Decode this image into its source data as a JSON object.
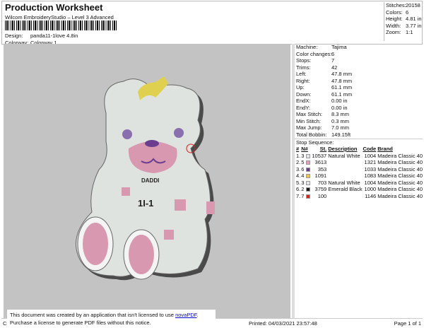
{
  "header": {
    "title": "Production Worksheet",
    "subtitle": "Wilcom EmbroideryStudio – Level 3 Advanced",
    "design_label": "Design:",
    "design": "panda11-1love 4.8in",
    "colorway_label": "Colorway:",
    "colorway": "Colorway 1"
  },
  "stats": [
    {
      "k": "Stitches:",
      "v": "20158"
    },
    {
      "k": "Colors:",
      "v": "6"
    },
    {
      "k": "Height:",
      "v": "4.81 in"
    },
    {
      "k": "Width:",
      "v": "3.77 in"
    },
    {
      "k": "Zoom:",
      "v": "1:1"
    }
  ],
  "machine": [
    {
      "k": "Machine:",
      "v": "Tajima"
    },
    {
      "k": "Color changes:",
      "v": "6"
    },
    {
      "k": "Stops:",
      "v": "7"
    },
    {
      "k": "Trims:",
      "v": "42"
    },
    {
      "k": "Left:",
      "v": "47.8 mm"
    },
    {
      "k": "Right:",
      "v": "47.8 mm"
    },
    {
      "k": "Up:",
      "v": "61.1 mm"
    },
    {
      "k": "Down:",
      "v": "61.1 mm"
    },
    {
      "k": "EndX:",
      "v": "0.00 in"
    },
    {
      "k": "EndY:",
      "v": "0.00 in"
    },
    {
      "k": "Max Stitch:",
      "v": "8.3 mm"
    },
    {
      "k": "Min Stitch:",
      "v": "0.3 mm"
    },
    {
      "k": "Max Jump:",
      "v": "7.0 mm"
    },
    {
      "k": "Total Bobbin:",
      "v": "149.15ft"
    }
  ],
  "stop_sequence": {
    "title": "Stop Sequence:",
    "headers": [
      "#",
      "N#",
      "St.",
      "Description",
      "Code",
      "Brand"
    ],
    "rows": [
      {
        "n": "1.",
        "nn": "3",
        "color": "#e4e4e8",
        "st": "10537",
        "desc": "Natural White",
        "code": "1004",
        "brand": "Madeira Classic 40"
      },
      {
        "n": "2.",
        "nn": "5",
        "color": "#e89ac0",
        "st": "3613",
        "desc": "",
        "code": "1321",
        "brand": "Madeira Classic 40"
      },
      {
        "n": "3.",
        "nn": "6",
        "color": "#6a3d8f",
        "st": "353",
        "desc": "",
        "code": "1033",
        "brand": "Madeira Classic 40"
      },
      {
        "n": "4.",
        "nn": "4",
        "color": "#f0c640",
        "st": "1091",
        "desc": "",
        "code": "1083",
        "brand": "Madeira Classic 40"
      },
      {
        "n": "5.",
        "nn": "3",
        "color": "#e4e4e8",
        "st": "703",
        "desc": "Natural White",
        "code": "1004",
        "brand": "Madeira Classic 40"
      },
      {
        "n": "6.",
        "nn": "2",
        "color": "#1a1a1a",
        "st": "3759",
        "desc": "Emerald Black",
        "code": "1000",
        "brand": "Madeira Classic 40"
      },
      {
        "n": "7.",
        "nn": "7",
        "color": "#d8201e",
        "st": "100",
        "desc": "",
        "code": "1146",
        "brand": "Madeira Classic 40"
      }
    ]
  },
  "footer": {
    "left": "Cr",
    "printed": "Printed: 04/03/2021 23:57:48",
    "page": "Page 1 of 1"
  },
  "notice": {
    "line1": "This document was created by an application that isn't licensed to use ",
    "link": "novaPDF",
    "line1_end": ".",
    "line2": "Purchase a license to generate PDF files without this notice."
  }
}
